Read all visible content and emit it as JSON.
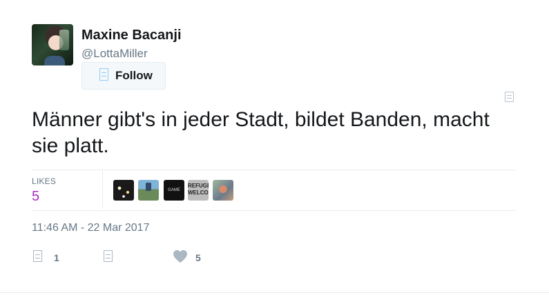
{
  "author": {
    "display_name": "Maxine Bacanji",
    "handle": "@LottaMiller"
  },
  "follow_button": {
    "label": "Follow",
    "icon": "bird-icon"
  },
  "tweet": {
    "text": "Männer gibt's in jeder Stadt, bildet Banden, macht sie platt.",
    "timestamp": "11:46 AM - 22 Mar 2017"
  },
  "stats": {
    "likes_label": "LIKES",
    "likes_count": "5"
  },
  "likers": [
    {
      "name": "liker-avatar-lights"
    },
    {
      "name": "liker-avatar-landscape"
    },
    {
      "name": "liker-avatar-game-over",
      "text": "GAME OVER"
    },
    {
      "name": "liker-avatar-refugees-welcome",
      "text": "REFUGEES WELCOME"
    },
    {
      "name": "liker-avatar-illustration"
    }
  ],
  "actions": {
    "reply_count": "1",
    "retweet_count": "",
    "like_count": "5"
  },
  "colors": {
    "text": "#14171a",
    "secondary": "#657786",
    "likes_accent": "#ab2cc7",
    "divider": "#e6ecf0"
  }
}
